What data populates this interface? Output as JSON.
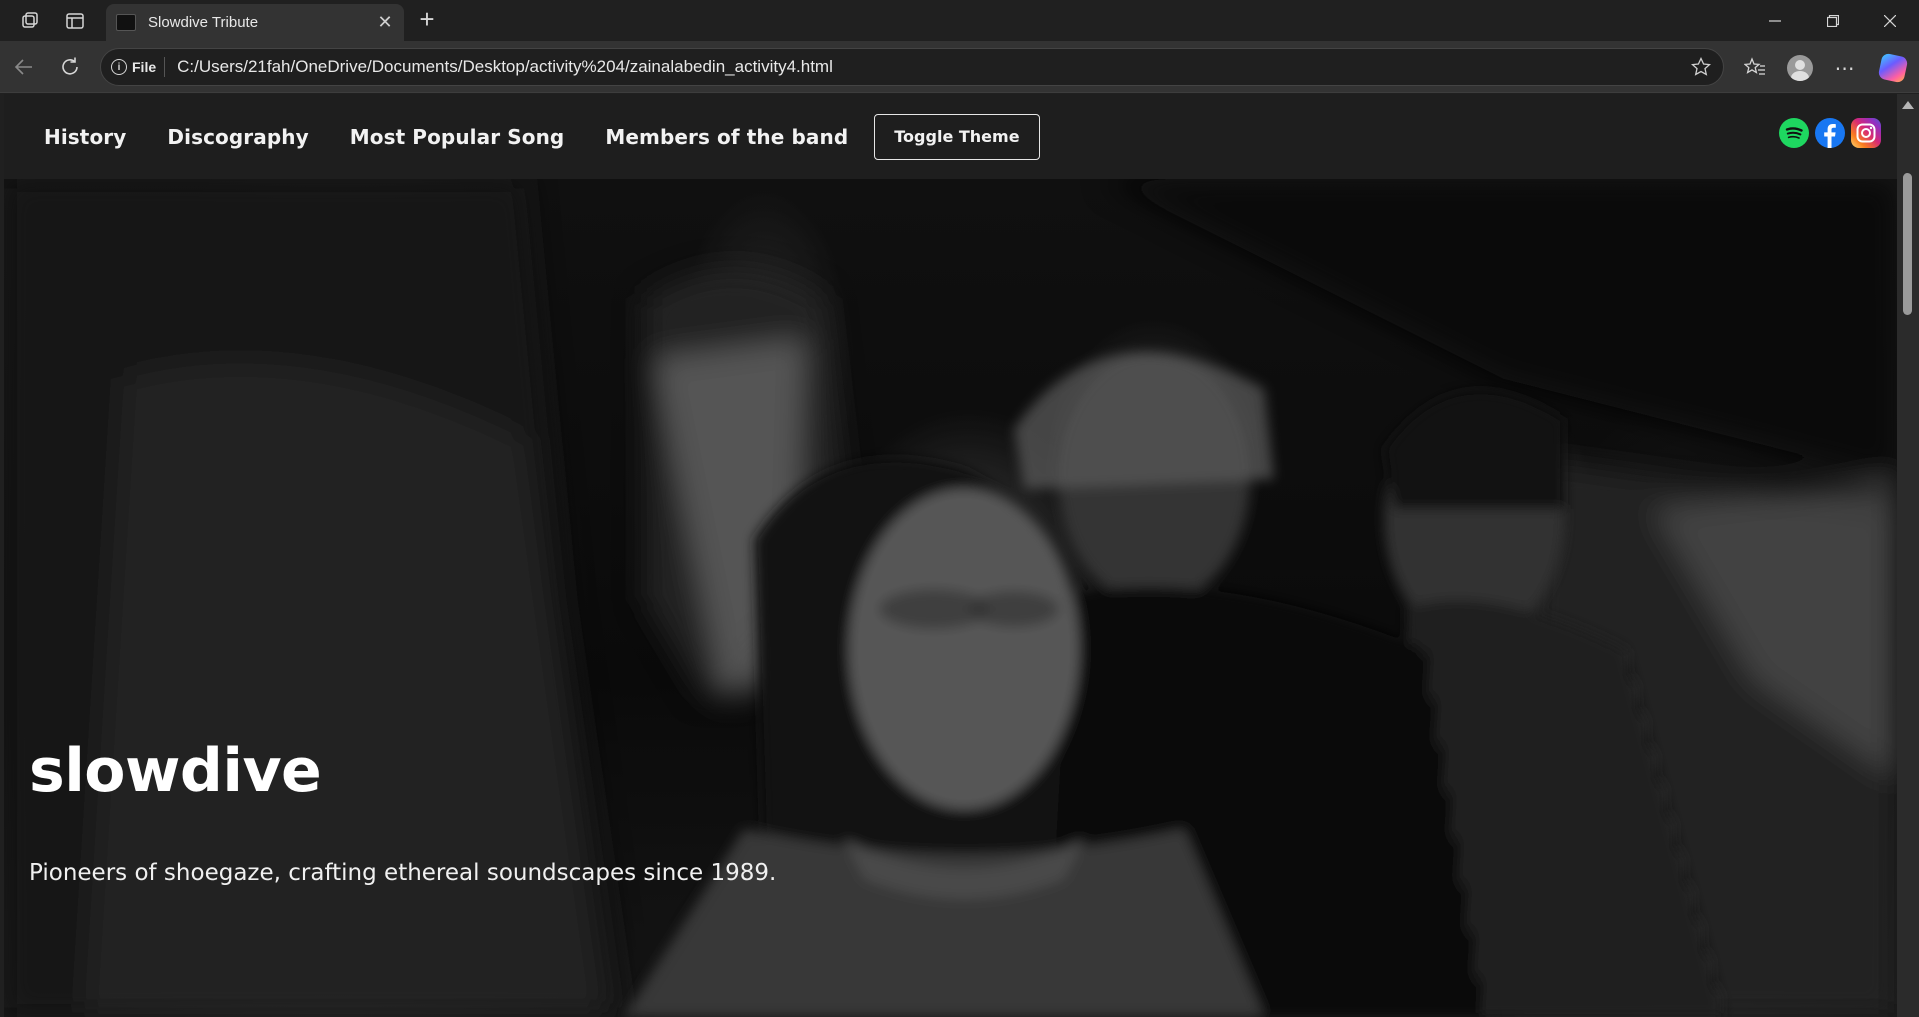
{
  "browser": {
    "tab_title": "Slowdive Tribute",
    "file_chip": "File",
    "url": "C:/Users/21fah/OneDrive/Documents/Desktop/activity%204/zainalabedin_activity4.html"
  },
  "site": {
    "nav": {
      "links": [
        "History",
        "Discography",
        "Most Popular Song",
        "Members of the band"
      ],
      "toggle_label": "Toggle Theme"
    },
    "socials": [
      "spotify-icon",
      "facebook-icon",
      "instagram-icon"
    ],
    "hero": {
      "title": "slowdive",
      "subtitle": "Pioneers of shoegaze, crafting ethereal soundscapes since 1989."
    }
  },
  "colors": {
    "nav_bg": "#1e1e1e",
    "spotify": "#1ed760",
    "facebook": "#1877f2"
  }
}
